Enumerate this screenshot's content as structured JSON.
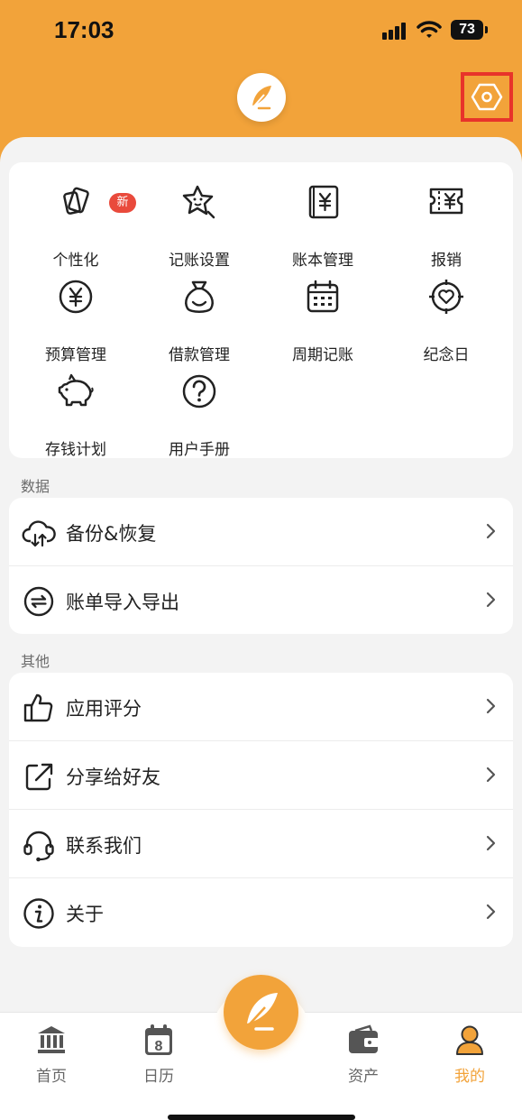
{
  "status": {
    "time": "17:03",
    "battery": "73"
  },
  "colors": {
    "accent": "#f2a33a",
    "badge": "#e94a3c",
    "highlight": "#e8332a"
  },
  "grid": [
    {
      "label": "个性化",
      "icon": "personalize-icon",
      "badge": "新"
    },
    {
      "label": "记账设置",
      "icon": "star-settings-icon"
    },
    {
      "label": "账本管理",
      "icon": "ledger-icon"
    },
    {
      "label": "报销",
      "icon": "reimburse-icon"
    },
    {
      "label": "预算管理",
      "icon": "budget-icon"
    },
    {
      "label": "借款管理",
      "icon": "loan-bag-icon"
    },
    {
      "label": "周期记账",
      "icon": "calendar-icon"
    },
    {
      "label": "纪念日",
      "icon": "heart-target-icon"
    },
    {
      "label": "存钱计划",
      "icon": "piggy-bank-icon"
    },
    {
      "label": "用户手册",
      "icon": "question-icon"
    }
  ],
  "sections": {
    "data": {
      "title": "数据",
      "items": [
        {
          "label": "备份&恢复",
          "icon": "cloud-sync-icon"
        },
        {
          "label": "账单导入导出",
          "icon": "import-export-icon"
        }
      ]
    },
    "other": {
      "title": "其他",
      "items": [
        {
          "label": "应用评分",
          "icon": "thumbs-up-icon"
        },
        {
          "label": "分享给好友",
          "icon": "share-icon"
        },
        {
          "label": "联系我们",
          "icon": "headset-icon"
        },
        {
          "label": "关于",
          "icon": "info-icon"
        }
      ]
    }
  },
  "tabbar": {
    "tabs": [
      {
        "label": "首页",
        "icon": "bank-icon"
      },
      {
        "label": "日历",
        "icon": "calendar-day-icon",
        "day": "8"
      },
      {
        "label": "资产",
        "icon": "wallet-icon"
      },
      {
        "label": "我的",
        "icon": "user-icon",
        "active": true
      }
    ]
  }
}
